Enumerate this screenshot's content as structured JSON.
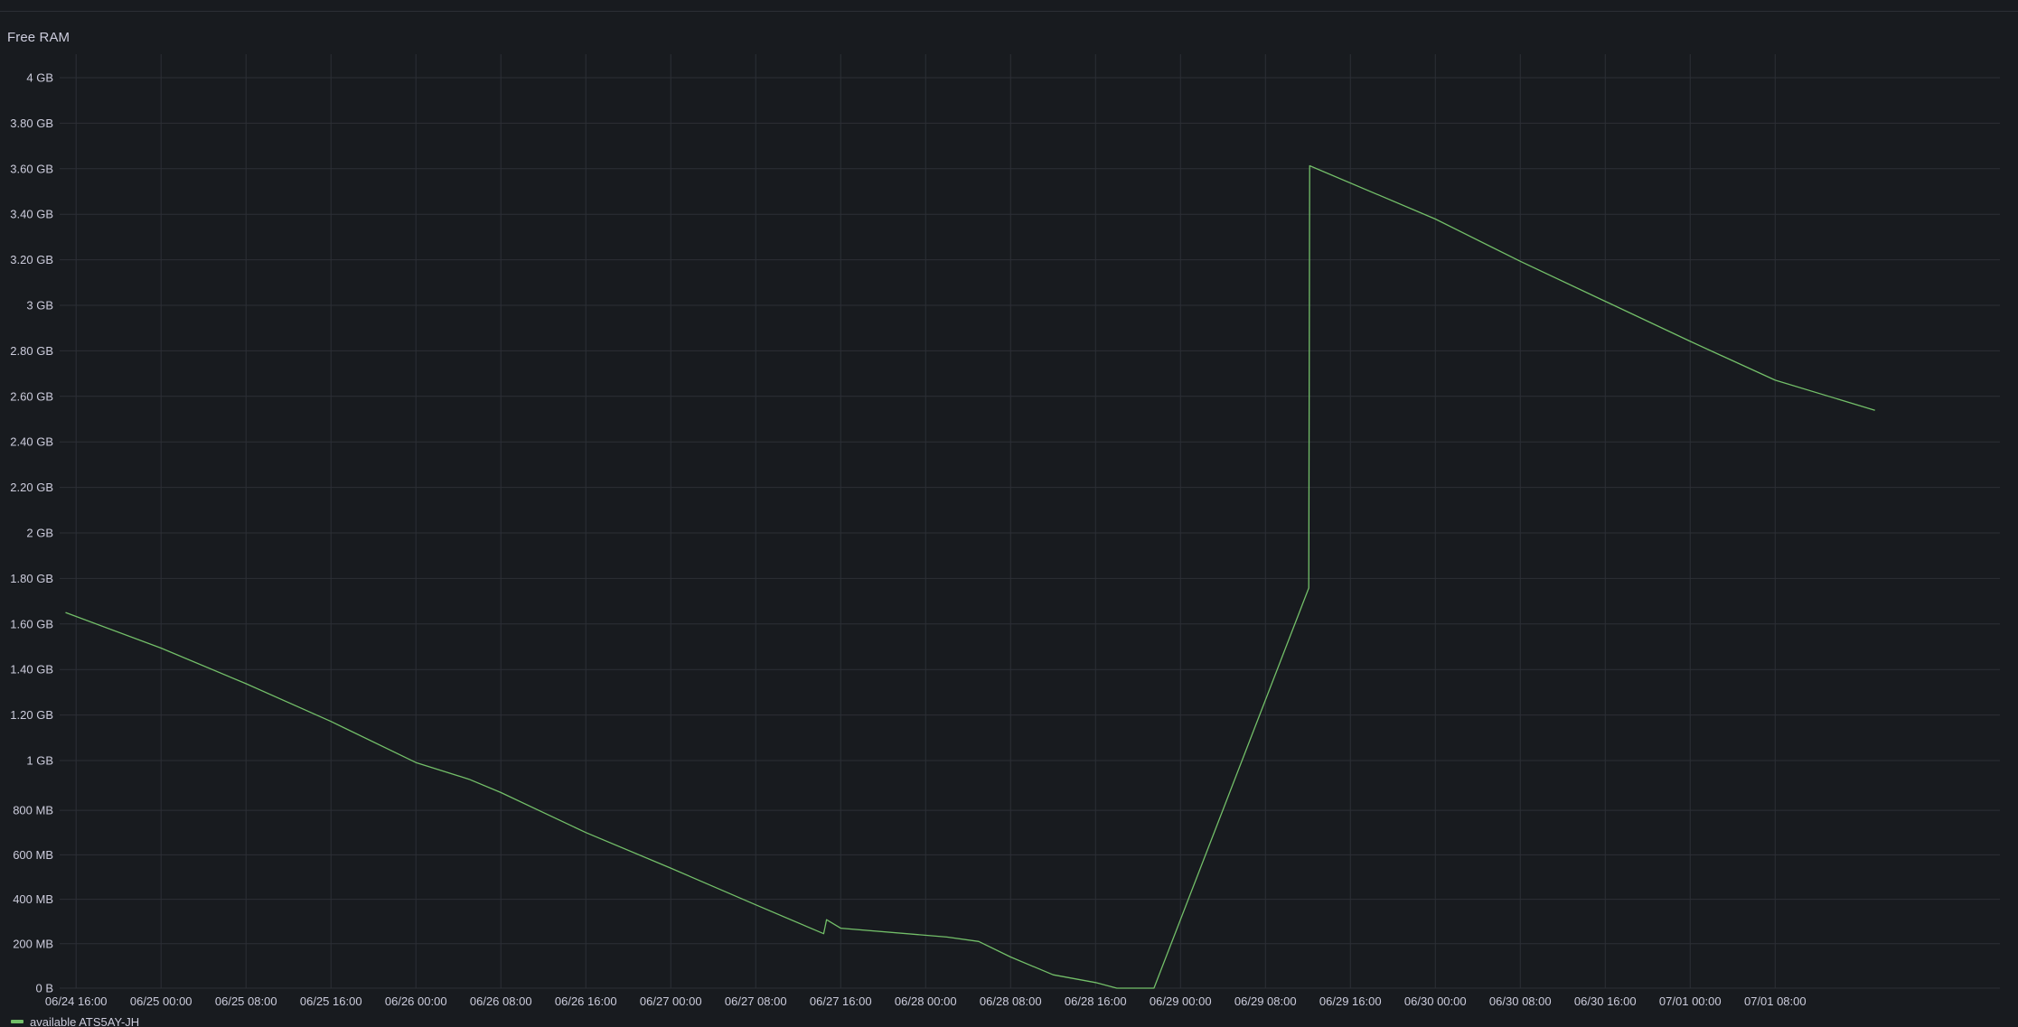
{
  "panel": {
    "title": "Free RAM"
  },
  "colors": {
    "background": "#181b1f",
    "grid": "#2c2f36",
    "series": "#73bf69",
    "text": "#ccccdc"
  },
  "chart_data": {
    "type": "line",
    "title": "Free RAM",
    "xlabel": "",
    "ylabel": "",
    "unit": "bytes",
    "x_range": [
      "2024-06-24T14:27",
      "2024-07-02T05:10"
    ],
    "y_range_bytes": [
      0,
      4294967296
    ],
    "y_ticks": [
      {
        "label": "0 B",
        "value_mb": 0
      },
      {
        "label": "200 MB",
        "value_mb": 200
      },
      {
        "label": "400 MB",
        "value_mb": 400
      },
      {
        "label": "600 MB",
        "value_mb": 600
      },
      {
        "label": "800 MB",
        "value_mb": 800
      },
      {
        "label": "1 GB",
        "value_mb": 1024
      },
      {
        "label": "1.20 GB",
        "value_mb": 1228.8
      },
      {
        "label": "1.40 GB",
        "value_mb": 1433.6
      },
      {
        "label": "1.60 GB",
        "value_mb": 1638.4
      },
      {
        "label": "1.80 GB",
        "value_mb": 1843.2
      },
      {
        "label": "2 GB",
        "value_mb": 2048
      },
      {
        "label": "2.20 GB",
        "value_mb": 2252.8
      },
      {
        "label": "2.40 GB",
        "value_mb": 2457.6
      },
      {
        "label": "2.60 GB",
        "value_mb": 2662.4
      },
      {
        "label": "2.80 GB",
        "value_mb": 2867.2
      },
      {
        "label": "3 GB",
        "value_mb": 3072
      },
      {
        "label": "3.20 GB",
        "value_mb": 3276.8
      },
      {
        "label": "3.40 GB",
        "value_mb": 3481.6
      },
      {
        "label": "3.60 GB",
        "value_mb": 3686.4
      },
      {
        "label": "3.80 GB",
        "value_mb": 3891.2
      },
      {
        "label": "4 GB",
        "value_mb": 4096
      }
    ],
    "x_ticks": [
      {
        "label": "06/24 16:00",
        "t": "2024-06-24T16:00"
      },
      {
        "label": "06/25 00:00",
        "t": "2024-06-25T00:00"
      },
      {
        "label": "06/25 08:00",
        "t": "2024-06-25T08:00"
      },
      {
        "label": "06/25 16:00",
        "t": "2024-06-25T16:00"
      },
      {
        "label": "06/26 00:00",
        "t": "2024-06-26T00:00"
      },
      {
        "label": "06/26 08:00",
        "t": "2024-06-26T08:00"
      },
      {
        "label": "06/26 16:00",
        "t": "2024-06-26T16:00"
      },
      {
        "label": "06/27 00:00",
        "t": "2024-06-27T00:00"
      },
      {
        "label": "06/27 08:00",
        "t": "2024-06-27T08:00"
      },
      {
        "label": "06/27 16:00",
        "t": "2024-06-27T16:00"
      },
      {
        "label": "06/28 00:00",
        "t": "2024-06-28T00:00"
      },
      {
        "label": "06/28 08:00",
        "t": "2024-06-28T08:00"
      },
      {
        "label": "06/28 16:00",
        "t": "2024-06-28T16:00"
      },
      {
        "label": "06/29 00:00",
        "t": "2024-06-29T00:00"
      },
      {
        "label": "06/29 08:00",
        "t": "2024-06-29T08:00"
      },
      {
        "label": "06/29 16:00",
        "t": "2024-06-29T16:00"
      },
      {
        "label": "06/30 00:00",
        "t": "2024-06-30T00:00"
      },
      {
        "label": "06/30 08:00",
        "t": "2024-06-30T08:00"
      },
      {
        "label": "06/30 16:00",
        "t": "2024-06-30T16:00"
      },
      {
        "label": "07/01 00:00",
        "t": "2024-07-01T00:00"
      },
      {
        "label": "07/01 08:00",
        "t": "2024-07-01T08:00"
      }
    ],
    "grid": true,
    "legend_position": "bottom-left",
    "series": [
      {
        "name": "available ATS5AY-JH",
        "color": "#73bf69",
        "points": [
          [
            "2024-06-24T15:00",
            1690
          ],
          [
            "2024-06-25T00:00",
            1530
          ],
          [
            "2024-06-25T08:00",
            1370
          ],
          [
            "2024-06-25T16:00",
            1200
          ],
          [
            "2024-06-26T00:00",
            1015
          ],
          [
            "2024-06-26T05:00",
            940
          ],
          [
            "2024-06-26T08:00",
            880
          ],
          [
            "2024-06-26T16:00",
            700
          ],
          [
            "2024-06-27T00:00",
            540
          ],
          [
            "2024-06-27T08:00",
            375
          ],
          [
            "2024-06-27T14:24",
            245
          ],
          [
            "2024-06-27T14:40",
            308
          ],
          [
            "2024-06-27T16:00",
            270
          ],
          [
            "2024-06-28T02:00",
            230
          ],
          [
            "2024-06-28T05:00",
            210
          ],
          [
            "2024-06-28T08:00",
            140
          ],
          [
            "2024-06-28T12:00",
            60
          ],
          [
            "2024-06-28T16:00",
            25
          ],
          [
            "2024-06-28T18:00",
            0
          ],
          [
            "2024-06-28T21:30",
            0
          ],
          [
            "2024-06-29T12:05",
            1800
          ],
          [
            "2024-06-29T12:10",
            3700
          ],
          [
            "2024-06-30T00:00",
            3460
          ],
          [
            "2024-06-30T08:00",
            3270
          ],
          [
            "2024-06-30T16:00",
            3090
          ],
          [
            "2024-07-01T00:00",
            2910
          ],
          [
            "2024-07-01T08:00",
            2735
          ],
          [
            "2024-07-01T17:24",
            2600
          ]
        ]
      }
    ]
  }
}
